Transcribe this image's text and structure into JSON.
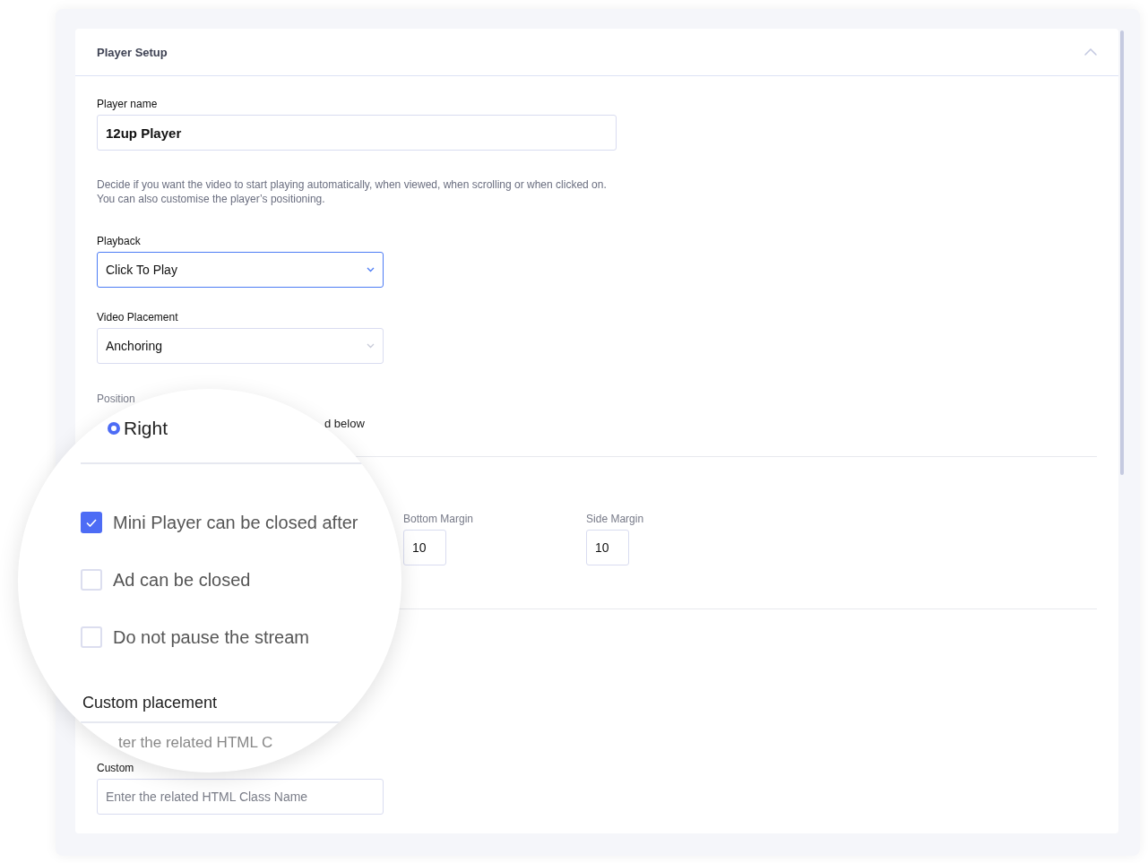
{
  "panel": {
    "title": "Player Setup",
    "expanded": true
  },
  "player_name": {
    "label": "Player name",
    "value": "12up Player"
  },
  "description": "Decide if you want the video to start playing automatically, when viewed, when scrolling or when clicked on.\nYou can also customise the player’s positioning.",
  "playback": {
    "label": "Playback",
    "value": "Click To Play",
    "focused": true
  },
  "video_placement": {
    "label": "Video Placement",
    "value": "Anchoring",
    "focused": false
  },
  "position": {
    "label": "Position",
    "option_text": "d below"
  },
  "margins": [
    {
      "label": "Bottom Margin",
      "value": "10"
    },
    {
      "label": "Side Margin",
      "value": "10"
    }
  ],
  "custom_placement": {
    "label": "Custom",
    "placeholder": "Enter the related HTML Class Name"
  },
  "magnifier": {
    "radio": {
      "label": "Right",
      "selected": true
    },
    "checkboxes": [
      {
        "label": "Mini Player can be closed after",
        "checked": true
      },
      {
        "label": "Ad can be closed",
        "checked": false
      },
      {
        "label": "Do not pause the stream",
        "checked": false
      }
    ],
    "heading": "Custom placement",
    "field_text": "ter the related HTML C"
  }
}
